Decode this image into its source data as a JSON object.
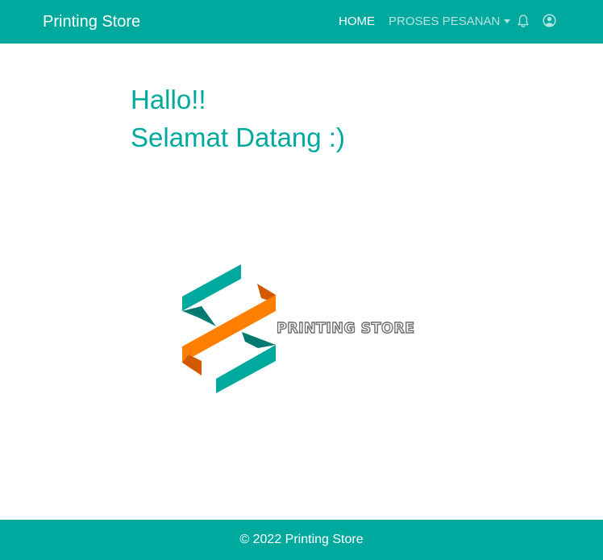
{
  "navbar": {
    "brand": "Printing Store",
    "links": {
      "home": "HOME",
      "proses_pesanan": "PROSES PESANAN"
    },
    "icons": [
      "bell-icon",
      "user-circle-icon"
    ],
    "background_color": "#00a99d",
    "active_link_color": "#ffffff",
    "inactive_link_color": "#b3e3df"
  },
  "main": {
    "greeting_line1": "Hallo!!",
    "greeting_line2": "Selamat Datang :)",
    "greeting_color": "#00a99d",
    "logo": {
      "text": "PRINTING STORE",
      "colors": {
        "teal": "#00a99d",
        "teal_dark": "#007a70",
        "orange": "#ff7f00",
        "orange_dark": "#d15a00"
      }
    }
  },
  "footer": {
    "text": "© 2022 Printing Store",
    "background_color": "#00a99d"
  }
}
